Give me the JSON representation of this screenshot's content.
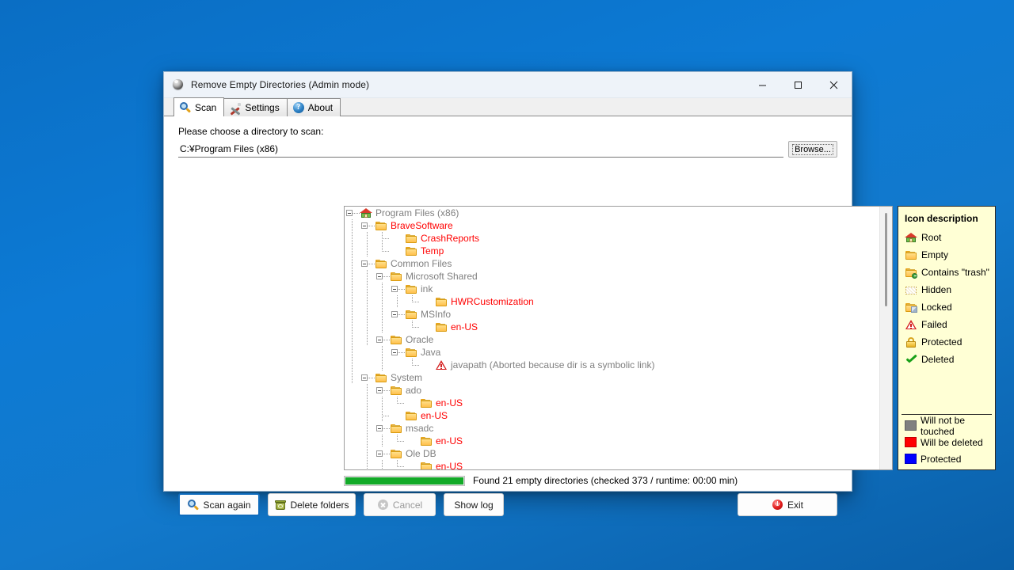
{
  "window": {
    "title": "Remove Empty Directories (Admin mode)",
    "icon": "app-ball-icon",
    "minimize_label": "—",
    "maximize_label": "□",
    "close_label": "✕"
  },
  "tabs": [
    {
      "label": "Scan",
      "icon": "magnifier-icon",
      "active": true
    },
    {
      "label": "Settings",
      "icon": "tools-icon",
      "active": false
    },
    {
      "label": "About",
      "icon": "question-circle-icon",
      "active": false
    }
  ],
  "scan_panel": {
    "choose_label": "Please choose a directory to scan:",
    "path_value": "C:¥Program Files (x86)",
    "path_placeholder": "C:¥",
    "browse_label": "Browse..."
  },
  "tree": [
    {
      "label": "Program Files (x86)",
      "depth": 0,
      "icon": "root-house-icon",
      "color": "grey",
      "expander": "minus",
      "guides": []
    },
    {
      "label": "BraveSoftware",
      "depth": 1,
      "icon": "folder-icon",
      "color": "red",
      "expander": "minus",
      "guides": [
        "vline"
      ]
    },
    {
      "label": "CrashReports",
      "depth": 2,
      "icon": "folder-icon",
      "color": "red",
      "expander": "none",
      "guides": [
        "vline",
        "vline",
        "tee"
      ]
    },
    {
      "label": "Temp",
      "depth": 2,
      "icon": "folder-icon",
      "color": "red",
      "expander": "none",
      "guides": [
        "vline",
        "vline",
        "ell"
      ]
    },
    {
      "label": "Common Files",
      "depth": 1,
      "icon": "folder-icon",
      "color": "grey",
      "expander": "minus",
      "guides": [
        "vline"
      ]
    },
    {
      "label": "Microsoft Shared",
      "depth": 2,
      "icon": "folder-icon",
      "color": "grey",
      "expander": "minus",
      "guides": [
        "vline",
        "vline"
      ]
    },
    {
      "label": "ink",
      "depth": 3,
      "icon": "folder-icon",
      "color": "grey",
      "expander": "minus",
      "guides": [
        "vline",
        "vline",
        "vline"
      ]
    },
    {
      "label": "HWRCustomization",
      "depth": 4,
      "icon": "folder-icon",
      "color": "red",
      "expander": "none",
      "guides": [
        "vline",
        "vline",
        "vline",
        "vline",
        "ell"
      ]
    },
    {
      "label": "MSInfo",
      "depth": 3,
      "icon": "folder-icon",
      "color": "grey",
      "expander": "minus",
      "guides": [
        "vline",
        "vline",
        "vline"
      ]
    },
    {
      "label": "en-US",
      "depth": 4,
      "icon": "folder-icon",
      "color": "red",
      "expander": "none",
      "guides": [
        "vline",
        "vline",
        "vline",
        "blank",
        "ell"
      ]
    },
    {
      "label": "Oracle",
      "depth": 2,
      "icon": "folder-icon",
      "color": "grey",
      "expander": "minus",
      "guides": [
        "vline",
        "vline"
      ]
    },
    {
      "label": "Java",
      "depth": 3,
      "icon": "folder-icon",
      "color": "grey",
      "expander": "minus",
      "guides": [
        "vline",
        "blank",
        "vline"
      ]
    },
    {
      "label": "javapath (Aborted because dir is a symbolic link)",
      "depth": 4,
      "icon": "warning-icon",
      "color": "grey",
      "expander": "none",
      "guides": [
        "vline",
        "blank",
        "vline",
        "blank",
        "ell"
      ]
    },
    {
      "label": "System",
      "depth": 1,
      "icon": "folder-icon",
      "color": "grey",
      "expander": "minus",
      "guides": [
        "vline"
      ]
    },
    {
      "label": "ado",
      "depth": 2,
      "icon": "folder-icon",
      "color": "grey",
      "expander": "minus",
      "guides": [
        "blank",
        "vline"
      ]
    },
    {
      "label": "en-US",
      "depth": 3,
      "icon": "folder-icon",
      "color": "red",
      "expander": "none",
      "guides": [
        "blank",
        "vline",
        "vline",
        "ell"
      ]
    },
    {
      "label": "en-US",
      "depth": 2,
      "icon": "folder-icon",
      "color": "red",
      "expander": "none",
      "guides": [
        "blank",
        "vline",
        "tee"
      ]
    },
    {
      "label": "msadc",
      "depth": 2,
      "icon": "folder-icon",
      "color": "grey",
      "expander": "minus",
      "guides": [
        "blank",
        "vline"
      ]
    },
    {
      "label": "en-US",
      "depth": 3,
      "icon": "folder-icon",
      "color": "red",
      "expander": "none",
      "guides": [
        "blank",
        "vline",
        "vline",
        "ell"
      ]
    },
    {
      "label": "Ole DB",
      "depth": 2,
      "icon": "folder-icon",
      "color": "grey",
      "expander": "minus",
      "guides": [
        "blank",
        "vline"
      ]
    },
    {
      "label": "en-US",
      "depth": 3,
      "icon": "folder-icon",
      "color": "red",
      "expander": "none",
      "guides": [
        "blank",
        "vline",
        "vline",
        "ell"
      ]
    }
  ],
  "legend": {
    "title": "Icon description",
    "items": [
      {
        "label": "Root",
        "icon": "root-house-icon"
      },
      {
        "label": "Empty",
        "icon": "folder-icon"
      },
      {
        "label": "Contains \"trash\"",
        "icon": "folder-trash-icon"
      },
      {
        "label": "Hidden",
        "icon": "folder-hidden-icon"
      },
      {
        "label": "Locked",
        "icon": "folder-locked-icon"
      },
      {
        "label": "Failed",
        "icon": "warning-icon"
      },
      {
        "label": "Protected",
        "icon": "padlock-icon"
      },
      {
        "label": "Deleted",
        "icon": "green-check-icon"
      }
    ],
    "colors": [
      {
        "label": "Will not be touched",
        "hex": "#808080"
      },
      {
        "label": "Will be deleted",
        "hex": "#ff0000"
      },
      {
        "label": "Protected",
        "hex": "#0000ff"
      }
    ]
  },
  "status": {
    "progress_percent": 100,
    "progress_color": "#12aa28",
    "text": "Found 21 empty directories (checked 373 / runtime: 00:00 min)"
  },
  "buttons": {
    "scan_again": {
      "label": "Scan again",
      "icon": "magnifier-icon",
      "disabled": false,
      "primary": true
    },
    "delete_folders": {
      "label": "Delete folders",
      "icon": "trash-icon",
      "disabled": false,
      "primary": false
    },
    "cancel": {
      "label": "Cancel",
      "icon": "cancel-icon",
      "disabled": true,
      "primary": false
    },
    "show_log": {
      "label": "Show log",
      "icon": "none",
      "disabled": false,
      "primary": false
    },
    "exit": {
      "label": "Exit",
      "icon": "power-icon",
      "disabled": false,
      "primary": false
    }
  }
}
